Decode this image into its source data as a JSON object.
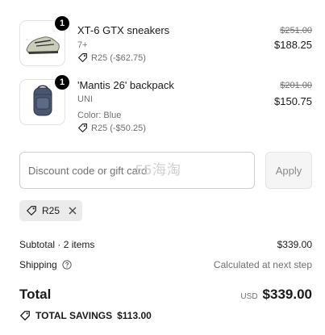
{
  "items": [
    {
      "qty": "1",
      "name": "XT-6 GTX sneakers",
      "variant": "7+",
      "discount": "R25 (-$62.75)",
      "original_price": "$251.00",
      "price": "$188.25"
    },
    {
      "qty": "1",
      "name": "'Mantis 26' backpack",
      "variant": "UNI",
      "color": "Color: Blue",
      "discount": "R25 (-$50.25)",
      "original_price": "$201.00",
      "price": "$150.75"
    }
  ],
  "discount_field": {
    "placeholder": "Discount code or gift card",
    "apply_label": "Apply"
  },
  "watermark": "55海淘",
  "applied_code": {
    "code": "R25"
  },
  "summary": {
    "subtotal_label": "Subtotal · 2 items",
    "subtotal_value": "$339.00",
    "shipping_label": "Shipping",
    "shipping_value": "Calculated at next step",
    "total_label": "Total",
    "currency": "USD",
    "total_value": "$339.00",
    "savings_label": "TOTAL SAVINGS",
    "savings_value": "$113.00"
  },
  "icons": {
    "tag": "tag-icon",
    "close": "close-icon",
    "help": "help-circle-icon"
  }
}
